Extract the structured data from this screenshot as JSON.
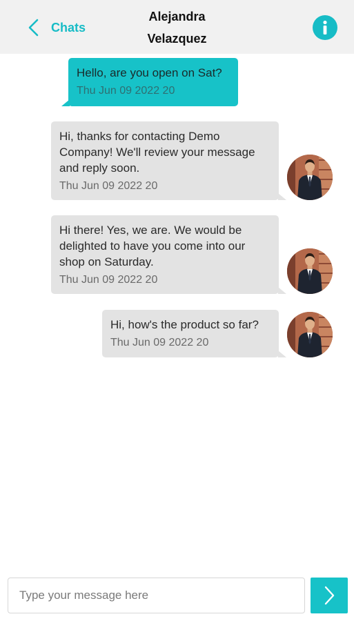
{
  "header": {
    "back_label": "Chats",
    "contact_name_line1": "Alejandra",
    "contact_name_line2": "Velazquez"
  },
  "messages": [
    {
      "direction": "outgoing",
      "text": "Hello, are you open on Sat?",
      "time": "Thu Jun 09 2022 20"
    },
    {
      "direction": "incoming",
      "text": "Hi, thanks for contacting Demo Company! We'll review your message and reply soon.",
      "time": "Thu Jun 09 2022 20"
    },
    {
      "direction": "incoming",
      "text": "Hi there! Yes, we are. We would be delighted to have you come into our shop on Saturday.",
      "time": "Thu Jun 09 2022 20"
    },
    {
      "direction": "incoming",
      "text": "Hi, how's the product so far?",
      "time": "Thu Jun 09 2022 20"
    }
  ],
  "composer": {
    "placeholder": "Type your message here",
    "value": ""
  },
  "icons": {
    "back": "chevron-left-icon",
    "info": "info-icon",
    "send": "chevron-right-icon"
  },
  "colors": {
    "accent": "#17bcc6",
    "incoming_bubble": "#e3e3e3",
    "header_bg": "#f1f1f1"
  }
}
